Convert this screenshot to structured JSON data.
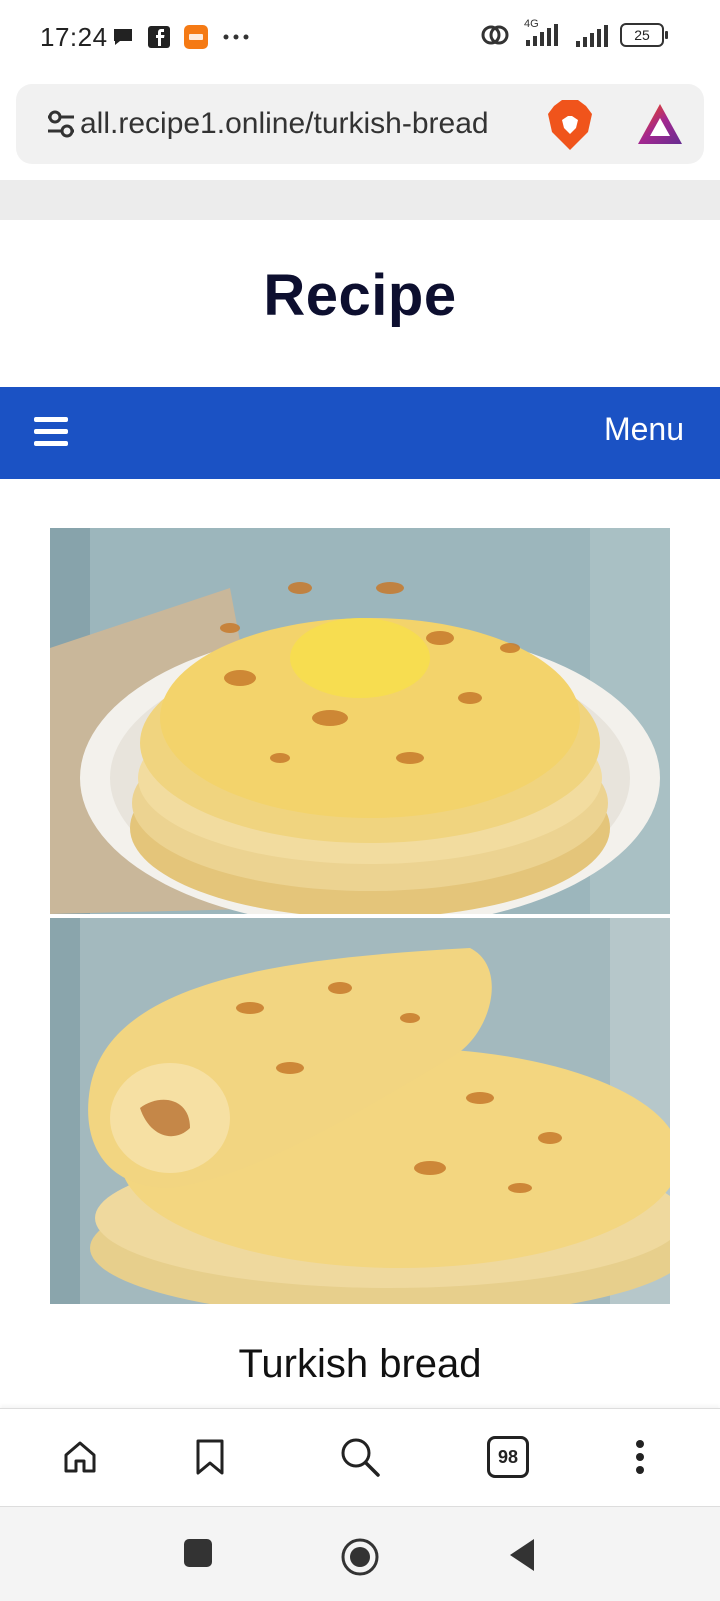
{
  "status_bar": {
    "time": "17:24",
    "network": "4G",
    "battery": "25"
  },
  "browser": {
    "url": "all.recipe1.online/turkish-bread"
  },
  "site": {
    "title": "Recipe",
    "menu_label": "Menu"
  },
  "article": {
    "title": "Turkish bread"
  },
  "toolbar": {
    "tabs_count": "98"
  },
  "colors": {
    "nav_bar": "#1b52c4",
    "title": "#0d0f2f"
  }
}
